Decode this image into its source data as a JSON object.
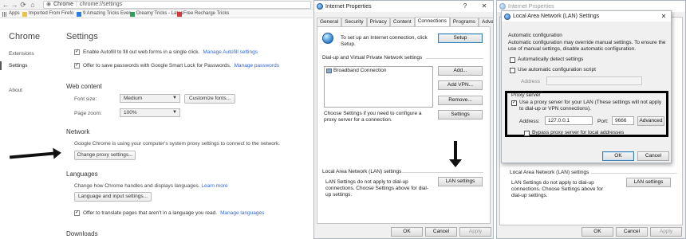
{
  "chrome": {
    "tab_label": "Chrome",
    "url": "chrome://settings",
    "bookmarks": [
      "Apps",
      "Imported From Firefo",
      "9 Amazing Tricks Ever",
      "Dreamy Tricks - Lates",
      "Free Recharge Tricks"
    ],
    "sidebar": {
      "title": "Chrome",
      "items": [
        "Extensions",
        "Settings",
        "About"
      ]
    },
    "page_title": "Settings",
    "autofill_text": "Enable Autofill to fill out web forms in a single click.",
    "autofill_link": "Manage Autofill settings",
    "passwords_text": "Offer to save passwords with Google Smart Lock for Passwords.",
    "passwords_link": "Manage passwords",
    "web_content": {
      "heading": "Web content",
      "font_size_label": "Font size:",
      "font_size_value": "Medium",
      "customize_fonts": "Customize fonts...",
      "page_zoom_label": "Page zoom:",
      "page_zoom_value": "100%"
    },
    "network": {
      "heading": "Network",
      "text": "Google Chrome is using your computer's system proxy settings to connect to the network.",
      "button": "Change proxy settings..."
    },
    "languages": {
      "heading": "Languages",
      "text": "Change how Chrome handles and displays languages.",
      "link": "Learn more",
      "button": "Language and input settings...",
      "translate_text": "Offer to translate pages that aren't in a language you read.",
      "translate_link": "Manage languages"
    },
    "downloads_heading": "Downloads"
  },
  "internet_properties": {
    "title": "Internet Properties",
    "help": "?",
    "close": "✕",
    "tabs": [
      "General",
      "Security",
      "Privacy",
      "Content",
      "Connections",
      "Programs",
      "Advanced"
    ],
    "active_tab": "Connections",
    "setup_text": "To set up an Internet connection, click Setup.",
    "setup_button": "Setup",
    "dialup_heading": "Dial-up and Virtual Private Network settings",
    "connections": [
      "Broadband Connection"
    ],
    "add_button": "Add...",
    "add_vpn_button": "Add VPN...",
    "remove_button": "Remove...",
    "settings_button": "Settings",
    "choose_text": "Choose Settings if you need to configure a proxy server for a connection.",
    "lan_heading": "Local Area Network (LAN) settings",
    "lan_text": "LAN Settings do not apply to dial-up connections. Choose Settings above for dial-up settings.",
    "lan_button": "LAN settings",
    "ok": "OK",
    "cancel": "Cancel",
    "apply": "Apply"
  },
  "lan_dialog": {
    "bg_title": "Internet Properties",
    "title": "Local Area Network (LAN) Settings",
    "auto_config_heading": "Automatic configuration",
    "auto_config_text": "Automatic configuration may override manual settings. To ensure the use of manual settings, disable automatic configuration.",
    "auto_detect": "Automatically detect settings",
    "use_script": "Use automatic configuration script",
    "address_label": "Address",
    "proxy_heading": "Proxy server",
    "use_proxy": "Use a proxy server for your LAN (These settings will not apply to dial-up or VPN connections).",
    "address_label2": "Address:",
    "address_value": "127.0.0.1",
    "port_label": "Port:",
    "port_value": "9666",
    "advanced_button": "Advanced",
    "bypass": "Bypass proxy server for local addresses",
    "ok": "OK",
    "cancel": "Cancel",
    "lan_heading": "Local Area Network (LAN) settings",
    "lan_text": "LAN Settings do not apply to dial-up connections. Choose Settings above for dial-up settings.",
    "lan_button": "LAN settings",
    "bg_ok": "OK",
    "bg_cancel": "Cancel",
    "bg_apply": "Apply"
  },
  "colors": {
    "link": "#3367d6",
    "highlight_border": "#000000",
    "dialog_bg": "#f0f0f0"
  }
}
